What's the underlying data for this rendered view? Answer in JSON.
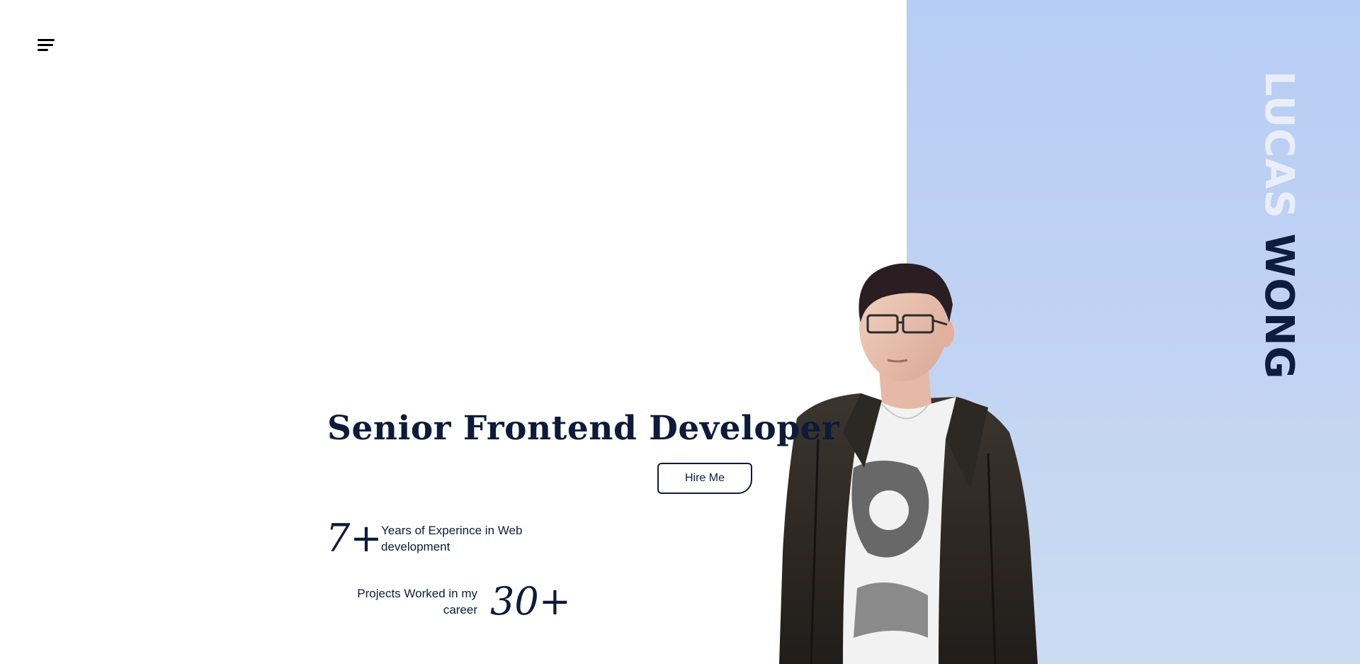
{
  "header": {
    "menu_icon": "hamburger-menu-icon"
  },
  "hero": {
    "name_first": "LUCAS",
    "name_last": "WONG",
    "title": "Senior Frontend Developer",
    "hire_label": "Hire Me",
    "portrait_alt": "Portrait of Lucas Wong",
    "stats": [
      {
        "number": "7+",
        "text": "Years of Experince in Web development"
      },
      {
        "number": "30+",
        "text": "Projects Worked in my career"
      }
    ]
  },
  "colors": {
    "accent_panel": "#b8cdf5",
    "text_dark": "#0d1b3a",
    "name_light": "#e9eef8"
  }
}
